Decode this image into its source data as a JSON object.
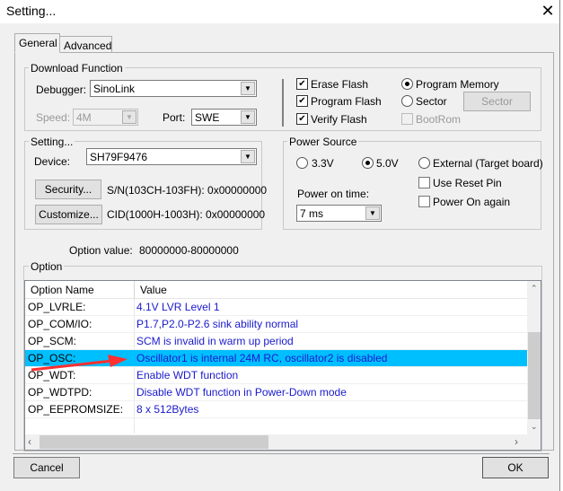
{
  "window": {
    "title": "Setting...",
    "close_icon": "close-icon"
  },
  "tabs": [
    {
      "label": "General",
      "active": true
    },
    {
      "label": "Advanced",
      "active": false
    }
  ],
  "download": {
    "title": "Download Function",
    "debugger_label": "Debugger:",
    "debugger_value": "SinoLink",
    "speed_label": "Speed:",
    "speed_value": "4M",
    "port_label": "Port:",
    "port_value": "SWE",
    "erase_flash": {
      "label": "Erase Flash",
      "checked": true
    },
    "program_flash": {
      "label": "Program Flash",
      "checked": true
    },
    "verify_flash": {
      "label": "Verify Flash",
      "checked": true
    },
    "program_memory": {
      "label": "Program Memory",
      "selected": true
    },
    "sector": {
      "label": "Sector",
      "selected": false
    },
    "sector_button": "Sector",
    "bootrom": {
      "label": "BootRom",
      "checked": false,
      "disabled": true
    }
  },
  "setting": {
    "title": "Setting...",
    "device_label": "Device:",
    "device_value": "SH79F9476",
    "security_button": "Security...",
    "sn_text": "S/N(103CH-103FH): 0x00000000",
    "customize_button": "Customize...",
    "cid_text": "CID(1000H-1003H): 0x00000000"
  },
  "power": {
    "title": "Power Source",
    "v33": "3.3V",
    "v50": "5.0V",
    "external": "External (Target board)",
    "selected": "5.0V",
    "use_reset_pin": {
      "label": "Use Reset Pin",
      "checked": false
    },
    "power_on_again": {
      "label": "Power On again",
      "checked": false
    },
    "power_on_time_label": "Power on time:",
    "power_on_time_value": "7 ms"
  },
  "option_value": {
    "label": "Option value:",
    "value": "80000000-80000000"
  },
  "option": {
    "title": "Option",
    "columns": [
      "Option Name",
      "Value"
    ],
    "rows": [
      {
        "name": "OP_LVRLE:",
        "value": "4.1V LVR Level 1"
      },
      {
        "name": "OP_COM/IO:",
        "value": "P1.7,P2.0-P2.6 sink ability normal"
      },
      {
        "name": "OP_SCM:",
        "value": "SCM is invalid in warm up period"
      },
      {
        "name": "OP_OSC:",
        "value": "Oscillator1 is internal 24M RC, oscillator2 is disabled",
        "selected": true
      },
      {
        "name": "OP_WDT:",
        "value": "Enable WDT function"
      },
      {
        "name": "OP_WDTPD:",
        "value": "Disable WDT function in Power-Down mode"
      },
      {
        "name": "OP_EEPROMSIZE:",
        "value": "8 x 512Bytes"
      }
    ]
  },
  "buttons": {
    "cancel": "Cancel",
    "ok": "OK"
  },
  "colors": {
    "selection": "#00bfff",
    "value_text": "#1a1acc",
    "annotation_arrow": "#ff3030"
  }
}
